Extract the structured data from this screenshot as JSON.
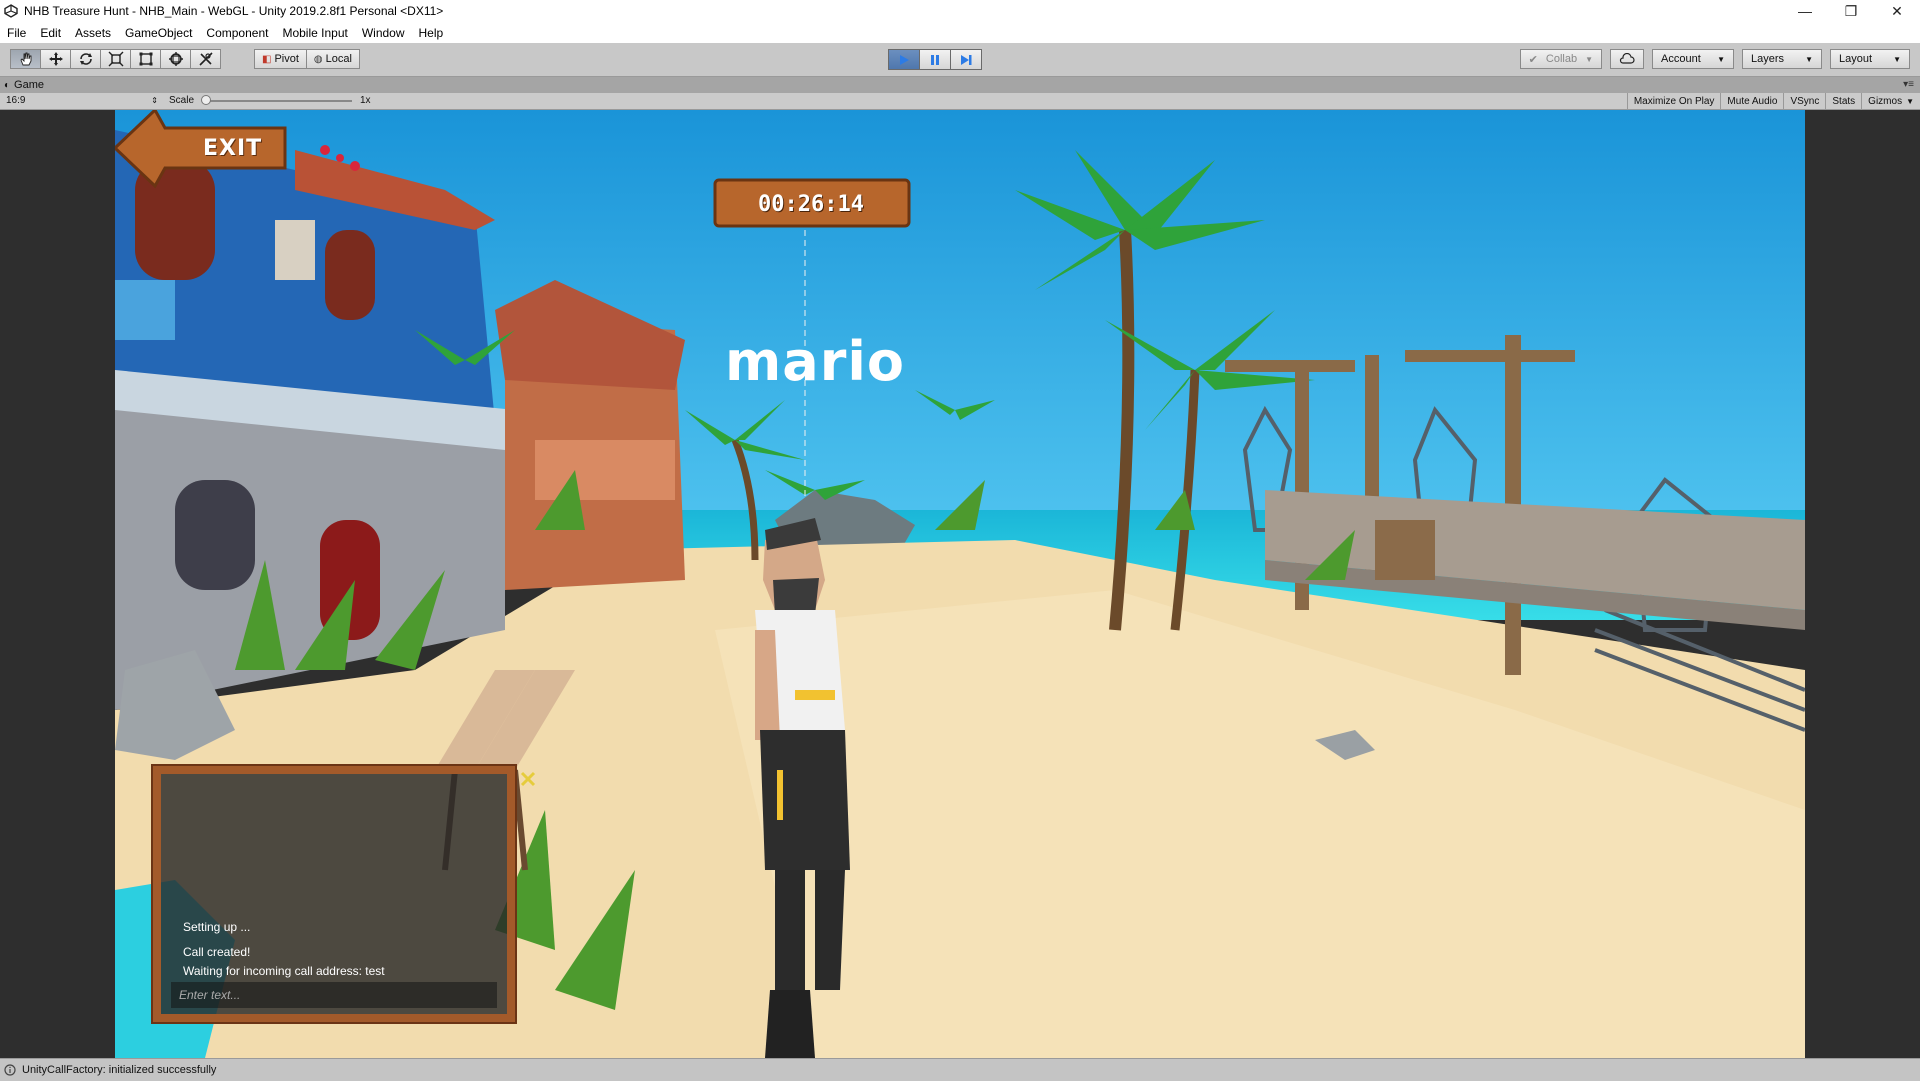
{
  "window": {
    "title": "NHB Treasure Hunt - NHB_Main - WebGL - Unity 2019.2.8f1 Personal <DX11>",
    "controls": {
      "minimize": "—",
      "restore": "❐",
      "close": "✕"
    }
  },
  "menu": [
    "File",
    "Edit",
    "Assets",
    "GameObject",
    "Component",
    "Mobile Input",
    "Window",
    "Help"
  ],
  "toolbar": {
    "tools": [
      "hand-tool",
      "move-tool",
      "rotate-tool",
      "scale-tool",
      "rect-tool",
      "transform-tool",
      "custom-tool"
    ],
    "pivot_label": "Pivot",
    "local_label": "Local",
    "collab_label": "Collab",
    "account_label": "Account",
    "layers_label": "Layers",
    "layout_label": "Layout"
  },
  "game_tab": {
    "label": "Game"
  },
  "game_toolbar": {
    "aspect": "16:9",
    "scale_label": "Scale",
    "scale_value": "1x",
    "options": [
      "Maximize On Play",
      "Mute Audio",
      "VSync",
      "Stats",
      "Gizmos"
    ]
  },
  "game": {
    "exit_label": "EXIT",
    "timer": "00:26:14",
    "player_name": "mario",
    "chat": {
      "lines": [
        "Setting up ...",
        "Call created!",
        "Waiting for incoming call address: test"
      ],
      "input_placeholder": "Enter text..."
    }
  },
  "status": {
    "message": "UnityCallFactory: initialized successfully"
  },
  "colors": {
    "sky": "#1ea4e0",
    "sea": "#25d3e6",
    "sand": "#f2dcae",
    "sign_wood": "#b7662c",
    "play_active": "#4f77ad"
  }
}
